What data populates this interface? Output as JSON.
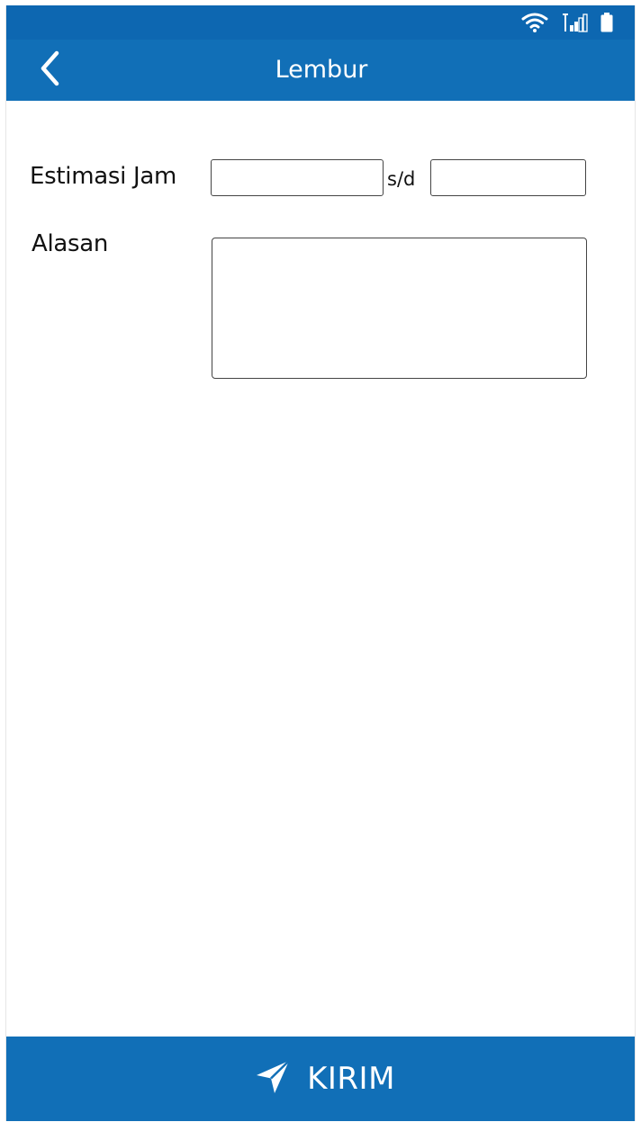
{
  "status_bar": {
    "icons": [
      "wifi-icon",
      "signal-icon",
      "battery-icon"
    ]
  },
  "app_bar": {
    "title": "Lembur",
    "back_icon": "chevron-left-icon"
  },
  "form": {
    "estimasi_label": "Estimasi Jam",
    "start_value": "",
    "separator": "s/d",
    "end_value": "",
    "alasan_label": "Alasan",
    "alasan_value": ""
  },
  "submit": {
    "label": "KIRIM",
    "icon": "send-icon"
  },
  "colors": {
    "primary": "#116fb7",
    "status_bar": "#0d67b1",
    "background": "#ffffff"
  }
}
